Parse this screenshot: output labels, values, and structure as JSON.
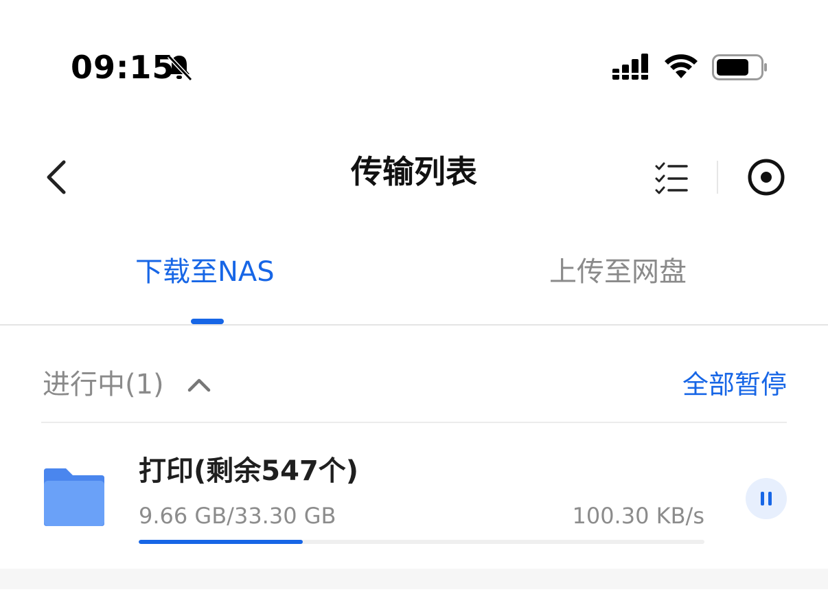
{
  "status_bar": {
    "time": "09:15",
    "icons": [
      "bell-muted-icon",
      "signal-icon",
      "wifi-icon",
      "battery-icon"
    ]
  },
  "nav": {
    "title": "传输列表",
    "icons": [
      "back-chevron-icon",
      "task-list-icon",
      "record-icon"
    ]
  },
  "tabs": [
    {
      "label": "下载至NAS",
      "active": true
    },
    {
      "label": "上传至网盘",
      "active": false
    }
  ],
  "section": {
    "title": "进行中(1)",
    "action": "全部暂停",
    "icon": "chevron-up-icon"
  },
  "transfers": [
    {
      "name": "打印(剩余547个)",
      "size": "9.66 GB/33.30 GB",
      "speed": "100.30 KB/s",
      "progress": 0.29,
      "icon": "folder-icon",
      "action_icon": "pause-icon"
    }
  ],
  "colors": {
    "accent": "#1766e6",
    "muted_text": "#8a8a8a",
    "pause_bg": "#e7effd",
    "folder": "#6aa1f8"
  }
}
